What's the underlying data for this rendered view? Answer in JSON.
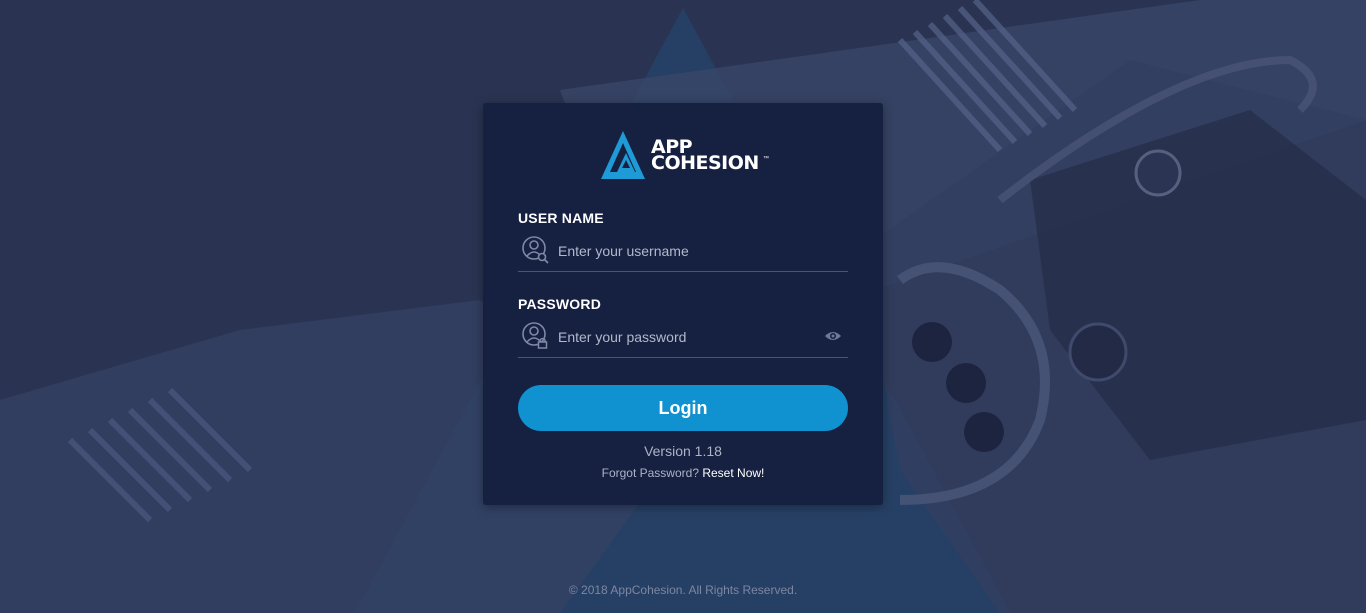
{
  "brand": {
    "line1": "APP",
    "line2": "COHESION",
    "trademark": "™"
  },
  "username": {
    "label": "USER NAME",
    "placeholder": "Enter your username",
    "value": ""
  },
  "password": {
    "label": "PASSWORD",
    "placeholder": "Enter your password",
    "value": ""
  },
  "login_label": "Login",
  "version_text": "Version 1.18",
  "forgot": {
    "prompt": "Forgot Password?",
    "link": "Reset Now!"
  },
  "footer_text": "© 2018 AppCohesion. All Rights Reserved.",
  "icons": {
    "logo": "appcohesion-triangle-logo",
    "username": "user-search-icon",
    "password": "user-lock-icon",
    "toggle": "eye-icon"
  },
  "colors": {
    "background": "#2a3452",
    "card": "#162040",
    "accent": "#0f92cf",
    "logo_blue": "#1e9ad6"
  }
}
